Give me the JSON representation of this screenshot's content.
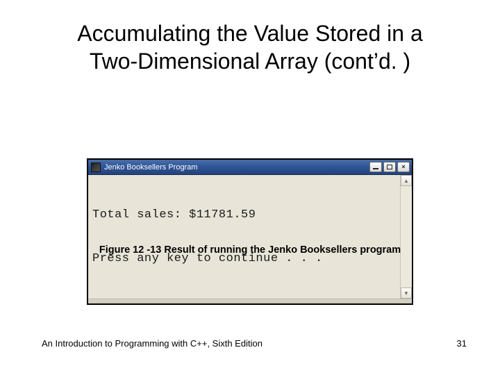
{
  "title_line1": "Accumulating the Value Stored in a",
  "title_line2": "Two-Dimensional Array (cont’d. )",
  "window": {
    "title": "Jenko Booksellers Program",
    "console_line1": "Total sales: $11781.59",
    "console_line2": "Press any key to continue . . ."
  },
  "caption": "Figure 12 -13 Result of running the Jenko Booksellers program",
  "footer_left": "An Introduction to Programming with C++, Sixth Edition",
  "footer_right": "31"
}
